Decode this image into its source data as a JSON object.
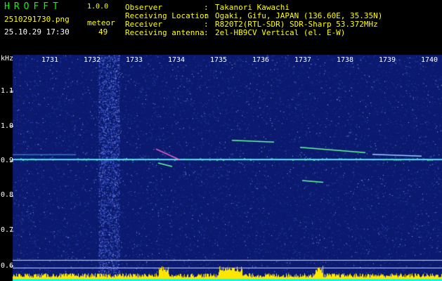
{
  "app": {
    "title": "HROFFT",
    "version": "1.0.0"
  },
  "capture": {
    "file_name": "2510291730.png",
    "date_time": "25.10.29 17:30",
    "meteor_label": "meteor",
    "meteor_count": "49"
  },
  "station": [
    {
      "label": "Observer",
      "value": "Takanori Kawachi"
    },
    {
      "label": "Receiving Location",
      "value": "Ogaki, Gifu, JAPAN (136.60E, 35.35N)"
    },
    {
      "label": "Receiver",
      "value": "R820T2(RTL-SDR) SDR-Sharp 53.372MHz"
    },
    {
      "label": "Receiving antenna",
      "value": "2el-HB9CV Vertical (el. E-W)"
    }
  ],
  "separator": ":",
  "axis": {
    "y_unit": "kHz",
    "y_ticks": [
      "1.1",
      "1.0",
      "0.9",
      "0.8",
      "0.7",
      "0.6"
    ],
    "x_ticks": [
      "1731",
      "1732",
      "1733",
      "1734",
      "1735",
      "1736",
      "1737",
      "1738",
      "1739",
      "1740"
    ]
  },
  "colors": {
    "background": "#000000",
    "plot_bg": "#0b1a6e",
    "noise": "#3b55d6",
    "signal": "#22ff88",
    "meteor_trace": "#ff66cc",
    "level_bar": "#ffe600",
    "level_edge": "#00ffff",
    "header_white": "#ffffff",
    "header_yellow": "#ffff00",
    "header_green": "#00ff00"
  },
  "signal_line_khz": 0.905
}
